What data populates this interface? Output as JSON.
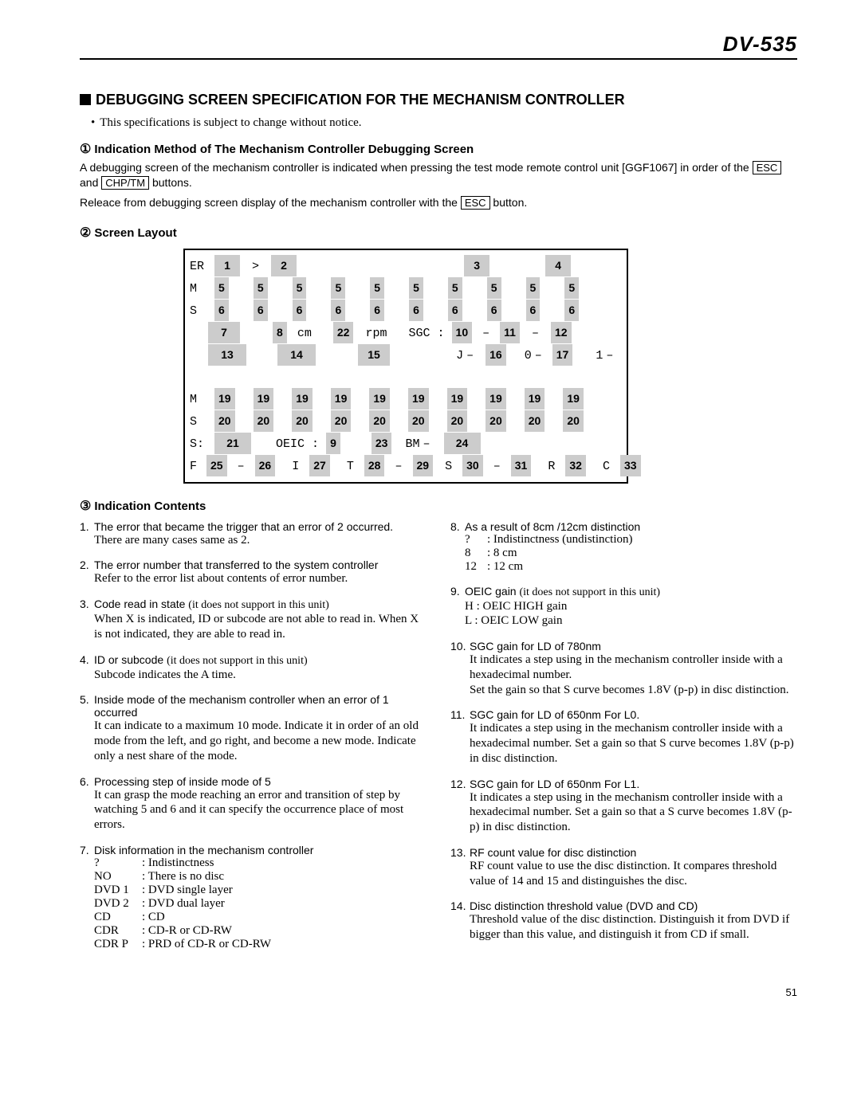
{
  "model": "DV-535",
  "title": "DEBUGGING SCREEN SPECIFICATION FOR THE MECHANISM CONTROLLER",
  "notice": "This specifications is subject to change without notice.",
  "sec1": {
    "num": "①",
    "title": "Indication Method of The Mechanism Controller Debugging Screen",
    "p1a": "A debugging screen of the mechanism controller is indicated when pressing the test mode remote control unit [GGF1067] in order of the ",
    "esc": "ESC",
    "p1b": " and ",
    "chp": "CHP/TM",
    "p1c": " buttons.",
    "p2a": "Releace from debugging screen display of the mechanism controller with the ",
    "p2b": " button."
  },
  "sec2": {
    "num": "②",
    "title": "Screen Layout"
  },
  "screen_labels": {
    "ER": "ER",
    "M": "M",
    "S": "S",
    "cm": "cm",
    "rpm": "rpm",
    "SGC": "SGC :",
    "J": "J",
    "zero": "0",
    "one": "1",
    "Scolon": "S:",
    "OEIC": "OEIC :",
    "BM": "BM",
    "F": "F",
    "I": "I",
    "T": "T",
    "Slet": "S",
    "R": "R",
    "C": "C",
    "gt": ">",
    "dash": "–"
  },
  "cells": {
    "c1": "1",
    "c2": "2",
    "c3": "3",
    "c4": "4",
    "c5": "5",
    "c6": "6",
    "c7": "7",
    "c8": "8",
    "c9": "9",
    "c10": "10",
    "c11": "11",
    "c12": "12",
    "c13": "13",
    "c14": "14",
    "c15": "15",
    "c16": "16",
    "c17": "17",
    "c19": "19",
    "c20": "20",
    "c21": "21",
    "c22": "22",
    "c23": "23",
    "c24": "24",
    "c25": "25",
    "c26": "26",
    "c27": "27",
    "c28": "28",
    "c29": "29",
    "c30": "30",
    "c31": "31",
    "c32": "32",
    "c33": "33"
  },
  "sec3": {
    "num": "③",
    "title": "Indication Contents"
  },
  "left": {
    "i1": {
      "n": "1.",
      "h": "The error that became the trigger that an error of 2 occurred.",
      "d": "There are many cases same as 2."
    },
    "i2": {
      "n": "2.",
      "h": "The error number that transferred to the system controller",
      "d": "Refer to the error list about contents of error number."
    },
    "i3": {
      "n": "3.",
      "h1": "Code read in state ",
      "h2": "(it does not support in this unit)",
      "d": "When X is indicated, ID or subcode are not able to read in. When X is not indicated, they are able to read in."
    },
    "i4": {
      "n": "4.",
      "h1": "ID or subcode ",
      "h2": "(it does not support in this unit)",
      "d": "Subcode indicates the A time."
    },
    "i5": {
      "n": "5.",
      "h": "Inside mode of the mechanism controller when an error of 1 occurred",
      "d": "It can indicate to a maximum 10 mode. Indicate it in order of an old mode from the left, and go right, and become a new mode. Indicate only a nest share of the mode."
    },
    "i6": {
      "n": "6.",
      "h": "Processing step of inside mode of 5",
      "d": "It can grasp the mode reaching an error and transition of step by watching 5 and 6 and it can specify the occurrence place of most errors."
    },
    "i7": {
      "n": "7.",
      "h": "Disk information in the mechanism controller",
      "rows": [
        {
          "k": "?",
          "w": "60",
          "v": ": Indistinctness"
        },
        {
          "k": "NO",
          "w": "60",
          "v": ": There is no disc"
        },
        {
          "k": "DVD 1",
          "w": "60",
          "v": ": DVD single layer"
        },
        {
          "k": "DVD 2",
          "w": "60",
          "v": ": DVD dual layer"
        },
        {
          "k": "CD",
          "w": "60",
          "v": ": CD"
        },
        {
          "k": "CDR",
          "w": "60",
          "v": ": CD-R or CD-RW"
        },
        {
          "k": "CDR P",
          "w": "60",
          "v": ": PRD of CD-R or CD-RW"
        }
      ]
    }
  },
  "right": {
    "i8": {
      "n": "8.",
      "h": "As a result of 8cm /12cm distinction",
      "rows": [
        {
          "k": "?",
          "w": "28",
          "v": ": Indistinctness (undistinction)"
        },
        {
          "k": "8",
          "w": "28",
          "v": ": 8 cm"
        },
        {
          "k": "12",
          "w": "28",
          "v": ": 12 cm"
        }
      ]
    },
    "i9": {
      "n": "9.",
      "h1": "OEIC gain ",
      "h2": "(it does not support in this unit)",
      "d": "H : OEIC HIGH gain\nL  : OEIC LOW gain"
    },
    "i10": {
      "n": "10.",
      "h": "SGC gain for LD of 780nm",
      "d": "It indicates a step using in the mechanism controller inside with a hexadecimal number.\nSet the gain so that S curve becomes 1.8V (p-p) in disc distinction."
    },
    "i11": {
      "n": "11.",
      "h": "SGC gain for LD of 650nm For L0.",
      "d": "It indicates a step using in the mechanism controller inside with a hexadecimal number. Set a gain so that S curve becomes 1.8V (p-p) in disc distinction."
    },
    "i12": {
      "n": "12.",
      "h": "SGC gain for LD of 650nm For L1.",
      "d": "It indicates a step using in the mechanism controller inside with a hexadecimal number. Set a gain so that a S curve becomes 1.8V (p-p) in disc distinction."
    },
    "i13": {
      "n": "13.",
      "h": "RF count value for disc distinction",
      "d": "RF count value to use the disc distinction. It compares threshold value of 14 and 15 and distinguishes the disc."
    },
    "i14": {
      "n": "14.",
      "h": "Disc distinction threshold value (DVD and CD)",
      "d": "Threshold value of the disc distinction. Distinguish it from DVD if bigger than this value, and distinguish it from CD if small."
    }
  },
  "pagenum": "51"
}
